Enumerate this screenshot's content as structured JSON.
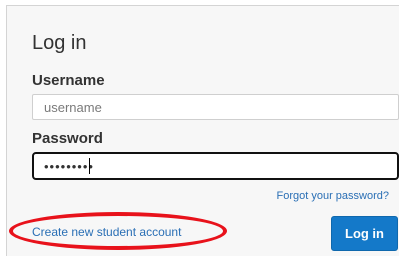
{
  "form": {
    "title": "Log in",
    "username_label": "Username",
    "username_placeholder": "username",
    "password_label": "Password",
    "password_value": "•••••••••",
    "forgot_link": "Forgot your password?",
    "create_account_link": "Create new student account",
    "login_button": "Log in"
  },
  "colors": {
    "link": "#2a6fb5",
    "button": "#1479c9",
    "highlight": "#e8121b"
  }
}
